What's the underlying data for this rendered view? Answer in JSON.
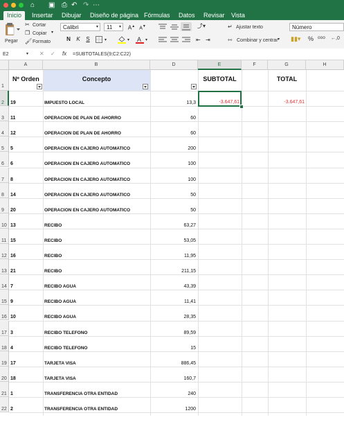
{
  "colors": {
    "accent": "#217346",
    "negative": "#e03030"
  },
  "tabs": [
    "Inicio",
    "Insertar",
    "Dibujar",
    "Diseño de página",
    "Fórmulas",
    "Datos",
    "Revisar",
    "Vista"
  ],
  "ribbon": {
    "paste_label": "Pegar",
    "cut_label": "Cortar",
    "copy_label": "Copiar",
    "format_label": "Formato",
    "font_name": "Calibri",
    "font_size": "11",
    "bold": "N",
    "italic": "K",
    "underline": "S",
    "wrap_text_label": "Ajustar texto",
    "merge_center_label": "Combinar y centrar",
    "number_format": "Número",
    "percent": "%"
  },
  "formula_bar": {
    "cell_ref": "E2",
    "fx": "fx",
    "formula": "=SUBTOTALES(9;C2:C22)"
  },
  "columns": [
    "A",
    "B",
    "D",
    "E",
    "F",
    "G",
    "H"
  ],
  "header_row": {
    "a": "Nº Orden",
    "b": "Concepto",
    "e": "SUBTOTAL",
    "g": "TOTAL"
  },
  "rows": [
    {
      "row": "2",
      "a": "19",
      "b": "IMPUESTO LOCAL",
      "d": "13,3",
      "e": "-3.647,61",
      "g": "-3.647,61"
    },
    {
      "row": "3",
      "a": "11",
      "b": "OPERACION DE PLAN DE AHORRO",
      "d": "60"
    },
    {
      "row": "4",
      "a": "12",
      "b": "OPERACION DE PLAN DE AHORRO",
      "d": "60"
    },
    {
      "row": "5",
      "a": "5",
      "b": "OPERACION EN CAJERO AUTOMATICO",
      "d": "200"
    },
    {
      "row": "6",
      "a": "6",
      "b": "OPERACION EN CAJERO AUTOMATICO",
      "d": "100"
    },
    {
      "row": "7",
      "a": "8",
      "b": "OPERACION EN CAJERO AUTOMATICO",
      "d": "100"
    },
    {
      "row": "8",
      "a": "14",
      "b": "OPERACION EN CAJERO AUTOMATICO",
      "d": "50"
    },
    {
      "row": "9",
      "a": "20",
      "b": "OPERACION EN CAJERO AUTOMATICO",
      "d": "50"
    },
    {
      "row": "10",
      "a": "13",
      "b": "RECIBO",
      "d": "63,27"
    },
    {
      "row": "11",
      "a": "15",
      "b": "RECIBO",
      "d": "53,05"
    },
    {
      "row": "12",
      "a": "16",
      "b": "RECIBO",
      "d": "11,95"
    },
    {
      "row": "13",
      "a": "21",
      "b": "RECIBO",
      "d": "211,15"
    },
    {
      "row": "14",
      "a": "7",
      "b": "RECIBO AGUA",
      "d": "43,39"
    },
    {
      "row": "15",
      "a": "9",
      "b": "RECIBO AGUA",
      "d": "11,41"
    },
    {
      "row": "16",
      "a": "10",
      "b": "RECIBO AGUA",
      "d": "28,35"
    },
    {
      "row": "17",
      "a": "3",
      "b": "RECIBO TELEFONO",
      "d": "89,59"
    },
    {
      "row": "18",
      "a": "4",
      "b": "RECIBO TELEFONO",
      "d": "15"
    },
    {
      "row": "19",
      "a": "17",
      "b": "TARJETA VISA",
      "d": "886,45"
    },
    {
      "row": "20",
      "a": "18",
      "b": "TARJETA VISA",
      "d": "160,7"
    },
    {
      "row": "21",
      "a": "1",
      "b": "TRANSFERENCIA OTRA ENTIDAD",
      "d": "240"
    },
    {
      "row": "22",
      "a": "2",
      "b": "TRANSFERENCIA OTRA ENTIDAD",
      "d": "1200"
    }
  ]
}
